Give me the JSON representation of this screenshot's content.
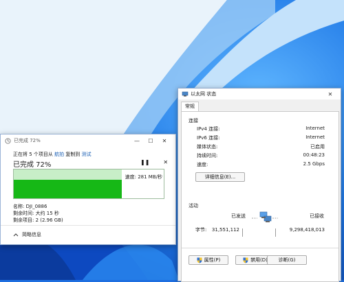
{
  "copy_dialog": {
    "title": "已完成 72%",
    "description_prefix": "正在将 5 个项目从",
    "source": "航拍",
    "copy_to_text": "复制到",
    "destination": "测试",
    "percent_label": "已完成 72%",
    "pause_glyph": "❚❚",
    "cancel_glyph": "✕",
    "progress_fraction": 0.72,
    "speed": "速度: 281 MB/秒",
    "name": "名称: DJI_0886",
    "time_remaining": "剩余时间: 大约 15 秒",
    "items_remaining": "剩余项目: 2 (2.96 GB)",
    "details_label": "简略信息",
    "minimize_glyph": "—",
    "maximize_glyph": "☐",
    "close_glyph": "✕"
  },
  "ethernet_dialog": {
    "title": "以太网 状态",
    "tab": "常规",
    "connection_section": "连接",
    "rows": [
      {
        "label": "IPv4 连接:",
        "value": "Internet"
      },
      {
        "label": "IPv6 连接:",
        "value": "Internet"
      },
      {
        "label": "媒体状态:",
        "value": "已启用"
      },
      {
        "label": "持续时间:",
        "value": "00:48:23"
      },
      {
        "label": "速度:",
        "value": "2.5 Gbps"
      }
    ],
    "details_button": "详细信息(E)...",
    "activity_section": "活动",
    "sent_label": "已发送",
    "received_label": "已接收",
    "bytes_label": "字节:",
    "bytes_sent": "31,551,112",
    "bytes_received": "9,298,418,013",
    "properties_button": "属性(P)",
    "disable_button": "禁用(D)",
    "diagnose_button": "诊断(G)",
    "close_glyph": "✕"
  },
  "colors": {
    "progress_green": "#16b816",
    "progress_light": "#c8eec8",
    "wallpaper_blue": "#1f6fe0"
  }
}
